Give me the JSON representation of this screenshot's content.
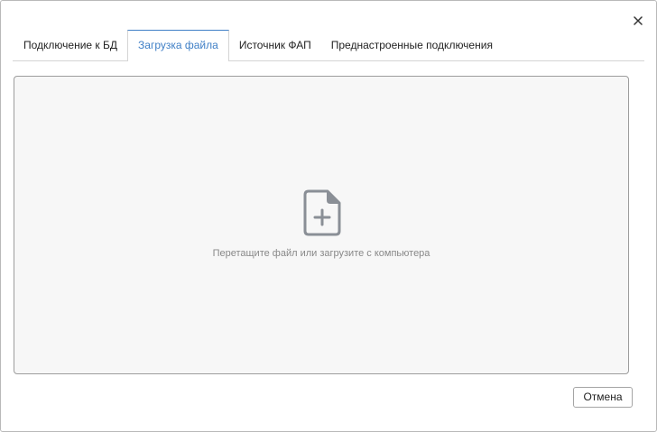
{
  "dialog": {
    "close_icon": "close-icon",
    "tabs": [
      {
        "label": "Подключение к БД",
        "active": false
      },
      {
        "label": "Загрузка файла",
        "active": true
      },
      {
        "label": "Источник ФАП",
        "active": false
      },
      {
        "label": "Преднастроенные подключения",
        "active": false
      }
    ],
    "dropzone": {
      "icon": "file-add-icon",
      "text": "Перетащите файл или загрузите с компьютера"
    },
    "footer": {
      "cancel_label": "Отмена"
    }
  },
  "colors": {
    "accent": "#3f7fc6",
    "icon_gray": "#8a8f96",
    "dropzone_bg": "#f7f7f7",
    "border": "#d4d4d4"
  }
}
